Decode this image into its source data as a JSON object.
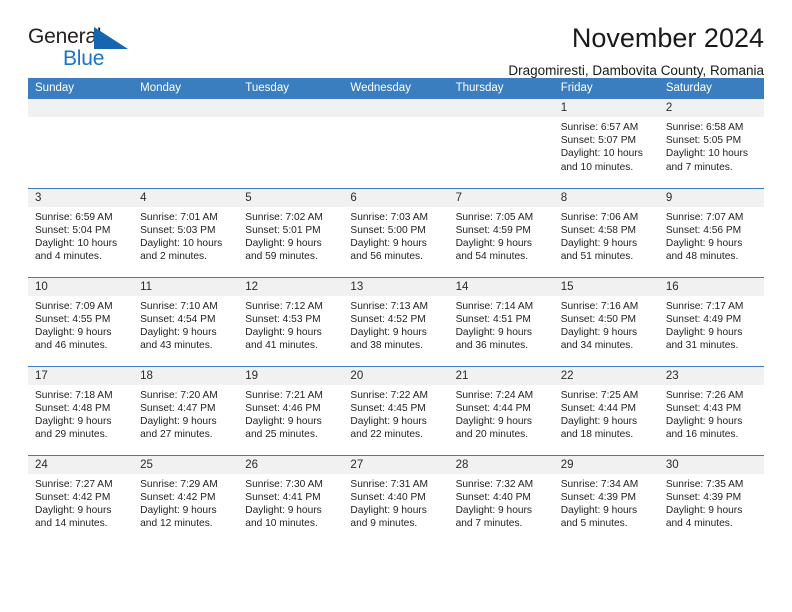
{
  "brand": {
    "line1": "General",
    "line2": "Blue",
    "triangle_color": "#1565b0"
  },
  "header": {
    "title": "November 2024",
    "subtitle": "Dragomiresti, Dambovita County, Romania"
  },
  "theme": {
    "header_row_background": "#3a7ebf",
    "header_row_text": "#ffffff",
    "daynum_background": "#f1f1f1",
    "grid_line": "#3a7ebf"
  },
  "weekdays": [
    "Sunday",
    "Monday",
    "Tuesday",
    "Wednesday",
    "Thursday",
    "Friday",
    "Saturday"
  ],
  "weeks": [
    [
      {
        "day": "",
        "sunrise": "",
        "sunset": "",
        "daylight_line1": "",
        "daylight_line2": ""
      },
      {
        "day": "",
        "sunrise": "",
        "sunset": "",
        "daylight_line1": "",
        "daylight_line2": ""
      },
      {
        "day": "",
        "sunrise": "",
        "sunset": "",
        "daylight_line1": "",
        "daylight_line2": ""
      },
      {
        "day": "",
        "sunrise": "",
        "sunset": "",
        "daylight_line1": "",
        "daylight_line2": ""
      },
      {
        "day": "",
        "sunrise": "",
        "sunset": "",
        "daylight_line1": "",
        "daylight_line2": ""
      },
      {
        "day": "1",
        "sunrise": "Sunrise: 6:57 AM",
        "sunset": "Sunset: 5:07 PM",
        "daylight_line1": "Daylight: 10 hours",
        "daylight_line2": "and 10 minutes."
      },
      {
        "day": "2",
        "sunrise": "Sunrise: 6:58 AM",
        "sunset": "Sunset: 5:05 PM",
        "daylight_line1": "Daylight: 10 hours",
        "daylight_line2": "and 7 minutes."
      }
    ],
    [
      {
        "day": "3",
        "sunrise": "Sunrise: 6:59 AM",
        "sunset": "Sunset: 5:04 PM",
        "daylight_line1": "Daylight: 10 hours",
        "daylight_line2": "and 4 minutes."
      },
      {
        "day": "4",
        "sunrise": "Sunrise: 7:01 AM",
        "sunset": "Sunset: 5:03 PM",
        "daylight_line1": "Daylight: 10 hours",
        "daylight_line2": "and 2 minutes."
      },
      {
        "day": "5",
        "sunrise": "Sunrise: 7:02 AM",
        "sunset": "Sunset: 5:01 PM",
        "daylight_line1": "Daylight: 9 hours",
        "daylight_line2": "and 59 minutes."
      },
      {
        "day": "6",
        "sunrise": "Sunrise: 7:03 AM",
        "sunset": "Sunset: 5:00 PM",
        "daylight_line1": "Daylight: 9 hours",
        "daylight_line2": "and 56 minutes."
      },
      {
        "day": "7",
        "sunrise": "Sunrise: 7:05 AM",
        "sunset": "Sunset: 4:59 PM",
        "daylight_line1": "Daylight: 9 hours",
        "daylight_line2": "and 54 minutes."
      },
      {
        "day": "8",
        "sunrise": "Sunrise: 7:06 AM",
        "sunset": "Sunset: 4:58 PM",
        "daylight_line1": "Daylight: 9 hours",
        "daylight_line2": "and 51 minutes."
      },
      {
        "day": "9",
        "sunrise": "Sunrise: 7:07 AM",
        "sunset": "Sunset: 4:56 PM",
        "daylight_line1": "Daylight: 9 hours",
        "daylight_line2": "and 48 minutes."
      }
    ],
    [
      {
        "day": "10",
        "sunrise": "Sunrise: 7:09 AM",
        "sunset": "Sunset: 4:55 PM",
        "daylight_line1": "Daylight: 9 hours",
        "daylight_line2": "and 46 minutes."
      },
      {
        "day": "11",
        "sunrise": "Sunrise: 7:10 AM",
        "sunset": "Sunset: 4:54 PM",
        "daylight_line1": "Daylight: 9 hours",
        "daylight_line2": "and 43 minutes."
      },
      {
        "day": "12",
        "sunrise": "Sunrise: 7:12 AM",
        "sunset": "Sunset: 4:53 PM",
        "daylight_line1": "Daylight: 9 hours",
        "daylight_line2": "and 41 minutes."
      },
      {
        "day": "13",
        "sunrise": "Sunrise: 7:13 AM",
        "sunset": "Sunset: 4:52 PM",
        "daylight_line1": "Daylight: 9 hours",
        "daylight_line2": "and 38 minutes."
      },
      {
        "day": "14",
        "sunrise": "Sunrise: 7:14 AM",
        "sunset": "Sunset: 4:51 PM",
        "daylight_line1": "Daylight: 9 hours",
        "daylight_line2": "and 36 minutes."
      },
      {
        "day": "15",
        "sunrise": "Sunrise: 7:16 AM",
        "sunset": "Sunset: 4:50 PM",
        "daylight_line1": "Daylight: 9 hours",
        "daylight_line2": "and 34 minutes."
      },
      {
        "day": "16",
        "sunrise": "Sunrise: 7:17 AM",
        "sunset": "Sunset: 4:49 PM",
        "daylight_line1": "Daylight: 9 hours",
        "daylight_line2": "and 31 minutes."
      }
    ],
    [
      {
        "day": "17",
        "sunrise": "Sunrise: 7:18 AM",
        "sunset": "Sunset: 4:48 PM",
        "daylight_line1": "Daylight: 9 hours",
        "daylight_line2": "and 29 minutes."
      },
      {
        "day": "18",
        "sunrise": "Sunrise: 7:20 AM",
        "sunset": "Sunset: 4:47 PM",
        "daylight_line1": "Daylight: 9 hours",
        "daylight_line2": "and 27 minutes."
      },
      {
        "day": "19",
        "sunrise": "Sunrise: 7:21 AM",
        "sunset": "Sunset: 4:46 PM",
        "daylight_line1": "Daylight: 9 hours",
        "daylight_line2": "and 25 minutes."
      },
      {
        "day": "20",
        "sunrise": "Sunrise: 7:22 AM",
        "sunset": "Sunset: 4:45 PM",
        "daylight_line1": "Daylight: 9 hours",
        "daylight_line2": "and 22 minutes."
      },
      {
        "day": "21",
        "sunrise": "Sunrise: 7:24 AM",
        "sunset": "Sunset: 4:44 PM",
        "daylight_line1": "Daylight: 9 hours",
        "daylight_line2": "and 20 minutes."
      },
      {
        "day": "22",
        "sunrise": "Sunrise: 7:25 AM",
        "sunset": "Sunset: 4:44 PM",
        "daylight_line1": "Daylight: 9 hours",
        "daylight_line2": "and 18 minutes."
      },
      {
        "day": "23",
        "sunrise": "Sunrise: 7:26 AM",
        "sunset": "Sunset: 4:43 PM",
        "daylight_line1": "Daylight: 9 hours",
        "daylight_line2": "and 16 minutes."
      }
    ],
    [
      {
        "day": "24",
        "sunrise": "Sunrise: 7:27 AM",
        "sunset": "Sunset: 4:42 PM",
        "daylight_line1": "Daylight: 9 hours",
        "daylight_line2": "and 14 minutes."
      },
      {
        "day": "25",
        "sunrise": "Sunrise: 7:29 AM",
        "sunset": "Sunset: 4:42 PM",
        "daylight_line1": "Daylight: 9 hours",
        "daylight_line2": "and 12 minutes."
      },
      {
        "day": "26",
        "sunrise": "Sunrise: 7:30 AM",
        "sunset": "Sunset: 4:41 PM",
        "daylight_line1": "Daylight: 9 hours",
        "daylight_line2": "and 10 minutes."
      },
      {
        "day": "27",
        "sunrise": "Sunrise: 7:31 AM",
        "sunset": "Sunset: 4:40 PM",
        "daylight_line1": "Daylight: 9 hours",
        "daylight_line2": "and 9 minutes."
      },
      {
        "day": "28",
        "sunrise": "Sunrise: 7:32 AM",
        "sunset": "Sunset: 4:40 PM",
        "daylight_line1": "Daylight: 9 hours",
        "daylight_line2": "and 7 minutes."
      },
      {
        "day": "29",
        "sunrise": "Sunrise: 7:34 AM",
        "sunset": "Sunset: 4:39 PM",
        "daylight_line1": "Daylight: 9 hours",
        "daylight_line2": "and 5 minutes."
      },
      {
        "day": "30",
        "sunrise": "Sunrise: 7:35 AM",
        "sunset": "Sunset: 4:39 PM",
        "daylight_line1": "Daylight: 9 hours",
        "daylight_line2": "and 4 minutes."
      }
    ]
  ]
}
